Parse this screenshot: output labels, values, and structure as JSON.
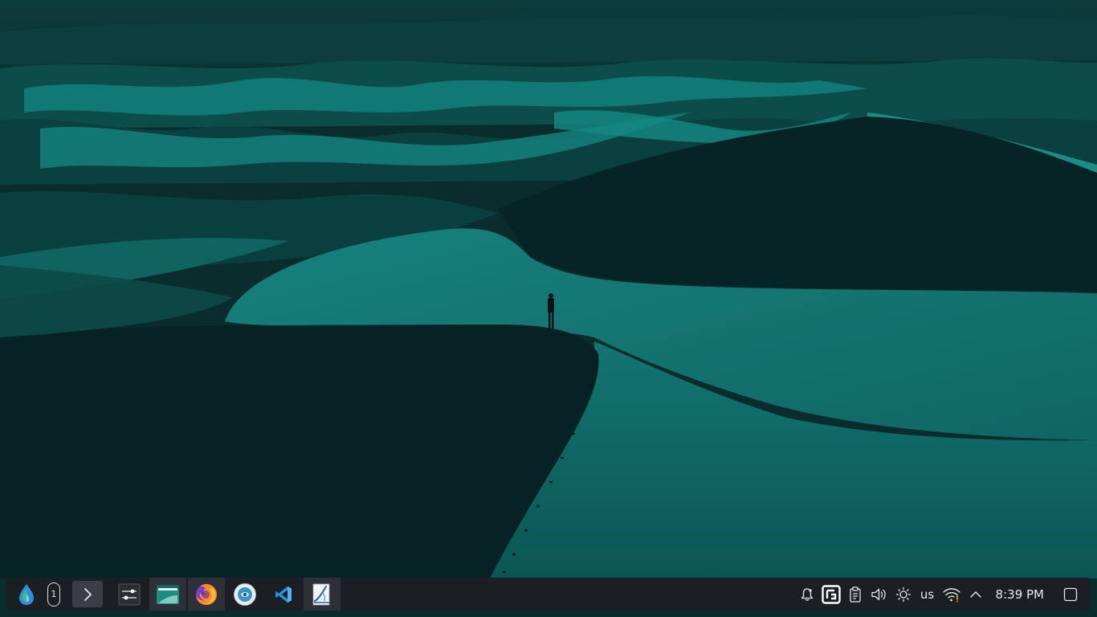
{
  "taskbar": {
    "workspace_number": "1",
    "apps": [
      {
        "name": "system-settings",
        "icon": "settings-sliders-icon",
        "running": false
      },
      {
        "name": "file-manager",
        "icon": "folder-icon",
        "running": true
      },
      {
        "name": "firefox",
        "icon": "firefox-icon",
        "running": true
      },
      {
        "name": "software-center",
        "icon": "software-center-icon",
        "running": false
      },
      {
        "name": "vscode",
        "icon": "vscode-icon",
        "running": false
      },
      {
        "name": "text-editor",
        "icon": "text-editor-icon",
        "running": true
      }
    ],
    "tray": {
      "keyboard_layout": "us"
    },
    "clock": "8:39 PM"
  },
  "colors": {
    "wallpaper_tint": "#0e5f5c",
    "wallpaper_dark": "#072224",
    "taskbar_bg": "#1b1f24",
    "active_app_bg": "#2c3137",
    "overview_bg": "#3a3f45",
    "text": "#e6e9ec"
  }
}
